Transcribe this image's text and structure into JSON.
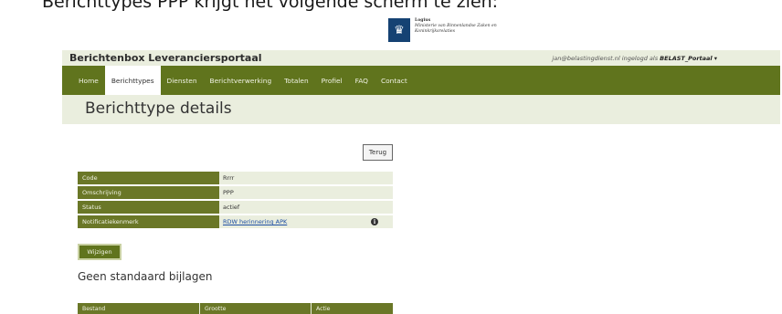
{
  "caption": "Berichttypes PPP krijgt het volgende scherm te zien:",
  "logo": {
    "line1": "Logius",
    "line2": "Ministerie van Binnenlandse Zaken en",
    "line3": "Koninkrijksrelaties"
  },
  "header": {
    "brand": "Berichtenbox Leveranciersportaal",
    "user_prefix": "jan@belastingdienst.nl ingelogd als ",
    "user_role": "BELAST_Portaal",
    "user_caret": "▾"
  },
  "nav": {
    "items": [
      {
        "label": "Home"
      },
      {
        "label": "Berichttypes"
      },
      {
        "label": "Diensten"
      },
      {
        "label": "Berichtverwerking"
      },
      {
        "label": "Totalen"
      },
      {
        "label": "Profiel"
      },
      {
        "label": "FAQ"
      },
      {
        "label": "Contact"
      }
    ],
    "active": "Berichttypes"
  },
  "page": {
    "title": "Berichttype details",
    "back_button": "Terug",
    "edit_button": "Wijzigen",
    "attachments_heading": "Geen standaard bijlagen"
  },
  "details": {
    "rows": [
      {
        "label": "Code",
        "value": "Rrrr"
      },
      {
        "label": "Omschrijving",
        "value": "PPP"
      },
      {
        "label": "Status",
        "value": "actief"
      },
      {
        "label": "Notificatiekenmerk",
        "value": "RDW herinnering APK"
      }
    ]
  },
  "attachments_table": {
    "columns": [
      "Bestand",
      "Grootte",
      "Actie"
    ]
  },
  "colors": {
    "nav_green": "#60741d",
    "light_bg": "#eaeede",
    "link": "#1f4fa3"
  },
  "icons": {
    "info": "info-icon"
  }
}
